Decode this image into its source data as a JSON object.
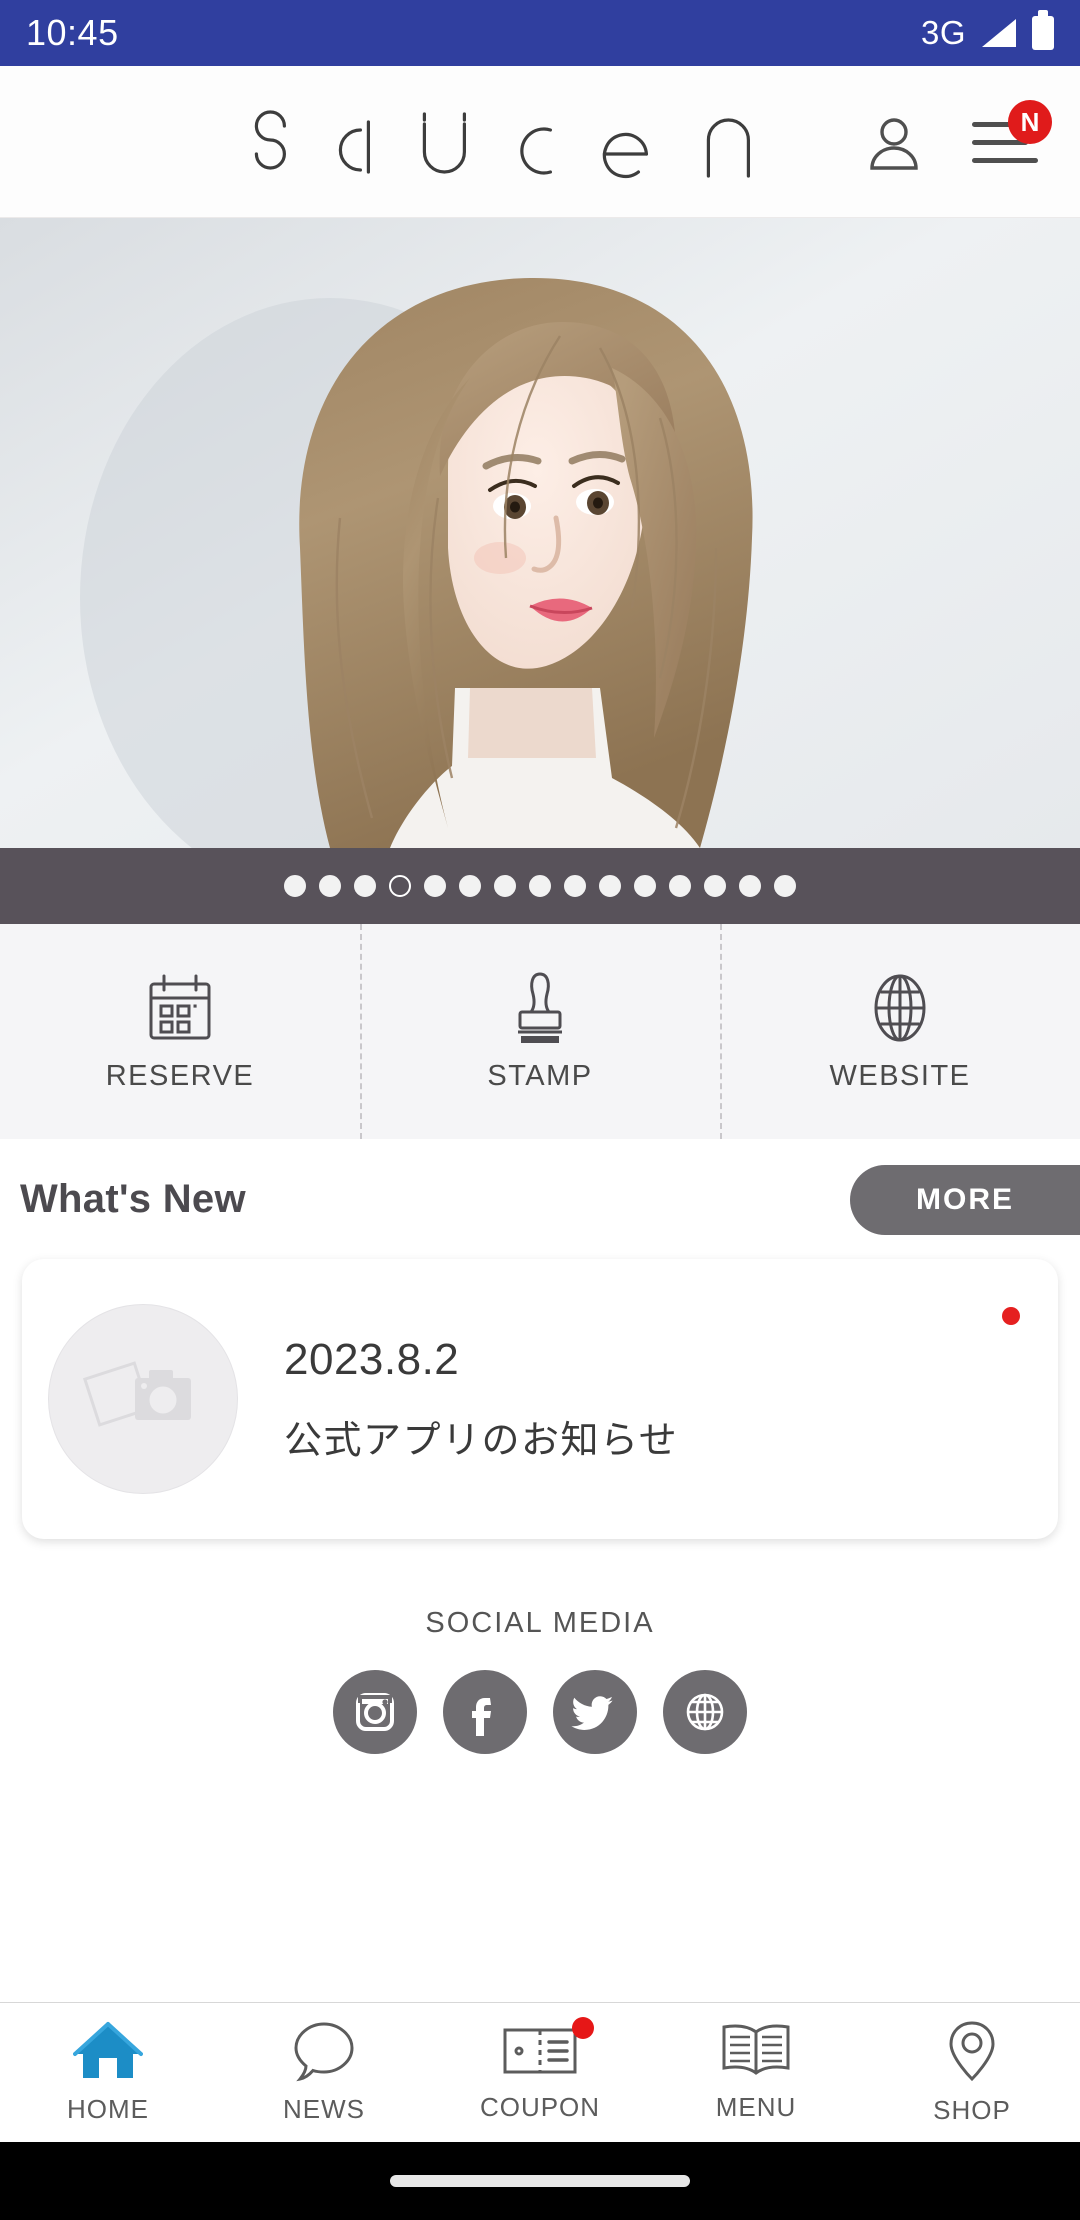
{
  "status_bar": {
    "time": "10:45",
    "network": "3G",
    "signal_icon": "signal-bars-icon",
    "battery_icon": "battery-full-icon",
    "background_color": "#303f9f"
  },
  "app_bar": {
    "logo_text": "saucer",
    "account_icon": "person-icon",
    "menu_icon": "hamburger-menu-icon",
    "menu_badge": "N",
    "badge_color": "#e01b1b"
  },
  "hero": {
    "alt": "woman with long light-brown layered hair against a pale grey wall",
    "carousel": {
      "total_dots": 15,
      "active_index": 3
    }
  },
  "quick_actions": [
    {
      "label": "RESERVE",
      "icon": "calendar-icon"
    },
    {
      "label": "STAMP",
      "icon": "stamp-icon"
    },
    {
      "label": "WEBSITE",
      "icon": "globe-icon"
    }
  ],
  "whats_new": {
    "title": "What's New",
    "more_label": "MORE",
    "items": [
      {
        "date": "2023.8.2",
        "title": "公式アプリのお知らせ",
        "thumbnail_icon": "photo-camera-placeholder-icon",
        "unread": true
      }
    ]
  },
  "social_media": {
    "title": "SOCIAL MEDIA",
    "links": [
      {
        "name": "instagram",
        "icon": "instagram-icon"
      },
      {
        "name": "facebook",
        "icon": "facebook-icon"
      },
      {
        "name": "twitter",
        "icon": "twitter-icon"
      },
      {
        "name": "website",
        "icon": "globe-icon"
      }
    ]
  },
  "bottom_nav": {
    "active": "HOME",
    "active_color": "#1c8dc6",
    "items": [
      {
        "label": "HOME",
        "icon": "home-icon",
        "badge": false
      },
      {
        "label": "NEWS",
        "icon": "speech-bubble-icon",
        "badge": false
      },
      {
        "label": "COUPON",
        "icon": "ticket-icon",
        "badge": true
      },
      {
        "label": "MENU",
        "icon": "open-book-icon",
        "badge": false
      },
      {
        "label": "SHOP",
        "icon": "location-pin-icon",
        "badge": false
      }
    ]
  },
  "gesture_bar": {
    "indicator": "home-indicator-pill"
  }
}
